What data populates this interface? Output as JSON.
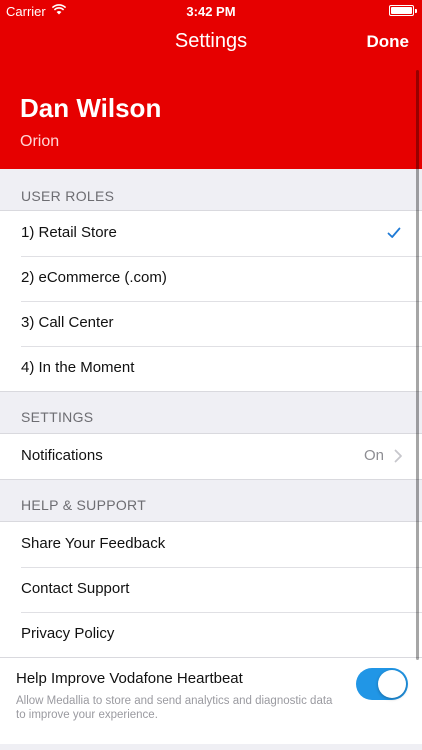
{
  "status_bar": {
    "carrier": "Carrier",
    "time": "3:42 PM"
  },
  "nav": {
    "title": "Settings",
    "done_label": "Done"
  },
  "profile": {
    "name": "Dan Wilson",
    "organization": "Orion"
  },
  "sections": {
    "user_roles": {
      "header": "USER ROLES",
      "items": [
        {
          "label": "1) Retail Store",
          "selected": true
        },
        {
          "label": "2) eCommerce (.com)",
          "selected": false
        },
        {
          "label": "3) Call Center",
          "selected": false
        },
        {
          "label": "4) In the Moment",
          "selected": false
        }
      ]
    },
    "settings": {
      "header": "SETTINGS",
      "notifications": {
        "label": "Notifications",
        "value": "On"
      }
    },
    "help": {
      "header": "HELP & SUPPORT",
      "items": [
        {
          "label": "Share Your Feedback"
        },
        {
          "label": "Contact Support"
        },
        {
          "label": "Privacy Policy"
        }
      ],
      "analytics": {
        "title": "Help Improve Vodafone Heartbeat",
        "description": "Allow Medallia to store and send analytics and diagnostic data to improve your experience.",
        "enabled": true
      }
    }
  },
  "colors": {
    "brand_red": "#e60000",
    "accent_blue": "#1e7ad6",
    "toggle_on": "#2196e6"
  },
  "icons": [
    "wifi-icon",
    "battery-icon",
    "checkmark-icon",
    "chevron-right-icon"
  ]
}
